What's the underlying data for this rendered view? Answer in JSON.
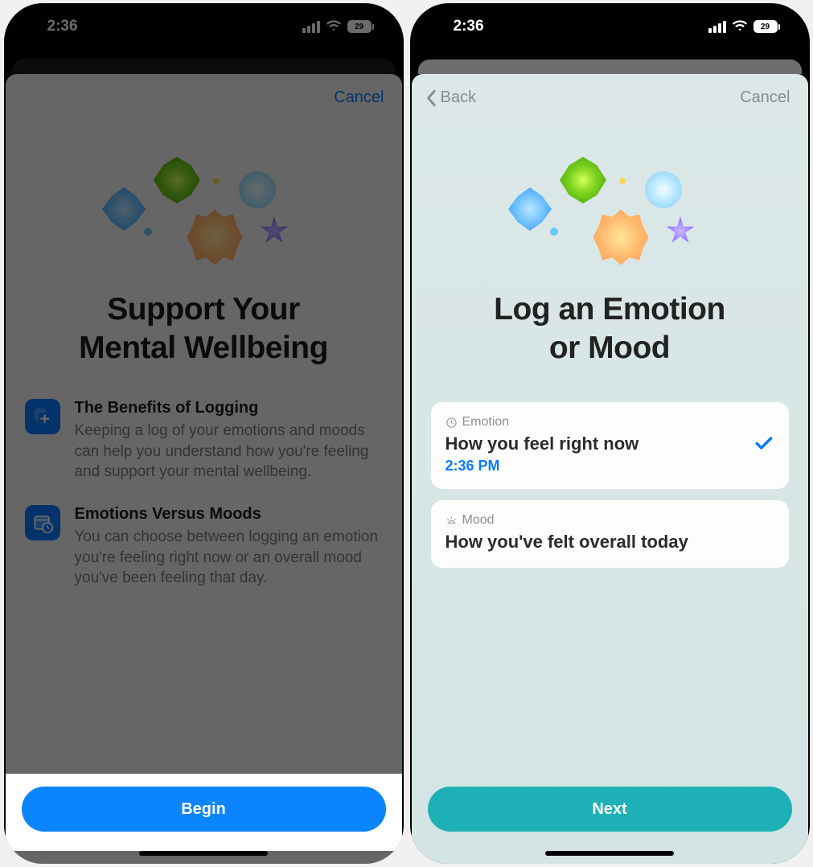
{
  "status": {
    "time": "2:36",
    "battery": "29"
  },
  "screen1": {
    "nav": {
      "cancel": "Cancel"
    },
    "title": "Support Your\nMental Wellbeing",
    "features": [
      {
        "heading": "The Benefits of Logging",
        "body": "Keeping a log of your emotions and moods can help you understand how you're feeling and support your mental wellbeing."
      },
      {
        "heading": "Emotions Versus Moods",
        "body": "You can choose between logging an emotion you're feeling right now or an overall mood you've been feeling that day."
      }
    ],
    "cta": "Begin"
  },
  "screen2": {
    "nav": {
      "back": "Back",
      "cancel": "Cancel"
    },
    "title": "Log an Emotion\nor Mood",
    "options": [
      {
        "label": "Emotion",
        "title": "How you feel right now",
        "time": "2:36 PM",
        "selected": true
      },
      {
        "label": "Mood",
        "title": "How you've felt overall today",
        "selected": false
      }
    ],
    "cta": "Next"
  }
}
